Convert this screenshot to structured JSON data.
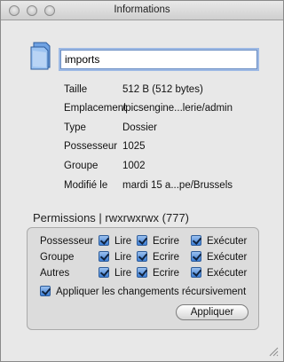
{
  "window": {
    "title": "Informations"
  },
  "name_field": {
    "value": "imports"
  },
  "info": {
    "rows": [
      {
        "label": "Taille",
        "value": "512 B (512 bytes)"
      },
      {
        "label": "Emplacement",
        "value": "/picsengine...lerie/admin"
      },
      {
        "label": "Type",
        "value": "Dossier"
      },
      {
        "label": "Possesseur",
        "value": "1025"
      },
      {
        "label": "Groupe",
        "value": "1002"
      },
      {
        "label": "Modifié le",
        "value": "mardi 15 a...pe/Brussels"
      }
    ]
  },
  "permissions": {
    "heading": "Permissions | rwxrwxrwx (777)",
    "rows": [
      {
        "label": "Possesseur",
        "read": "Lire",
        "write": "Ecrire",
        "exec": "Exécuter"
      },
      {
        "label": "Groupe",
        "read": "Lire",
        "write": "Ecrire",
        "exec": "Exécuter"
      },
      {
        "label": "Autres",
        "read": "Lire",
        "write": "Ecrire",
        "exec": "Exécuter"
      }
    ],
    "recursive_label": "Appliquer les changements récursivement",
    "apply_label": "Appliquer"
  },
  "colors": {
    "checkbox": "#3d7fd6",
    "focus_ring": "#9db9e4",
    "window_bg": "#e8e8e8"
  }
}
